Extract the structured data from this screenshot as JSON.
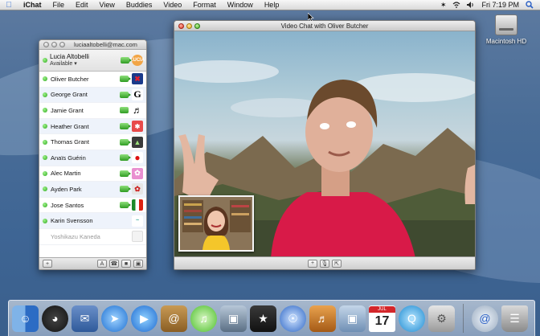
{
  "menubar": {
    "app_name": "iChat",
    "menus": [
      "File",
      "Edit",
      "View",
      "Buddies",
      "Video",
      "Format",
      "Window",
      "Help"
    ],
    "clock": "Fri 7:19 PM"
  },
  "desktop": {
    "hd_label": "Macintosh HD"
  },
  "buddy_list": {
    "account": "luciaaltobelli@mac.com",
    "my_name": "Lucia Altobelli",
    "my_status": "Available ▾",
    "buddies": [
      {
        "name": "Oliver Butcher",
        "online": true,
        "cam": true
      },
      {
        "name": "George Grant",
        "online": true,
        "cam": true
      },
      {
        "name": "Jamie Grant",
        "online": true,
        "phone": true
      },
      {
        "name": "Heather Grant",
        "online": true,
        "cam": true
      },
      {
        "name": "Thomas Grant",
        "online": true,
        "cam": true
      },
      {
        "name": "Anaïs Guérin",
        "online": true,
        "cam": true
      },
      {
        "name": "Alec Martin",
        "online": true,
        "cam": true
      },
      {
        "name": "Ayden Park",
        "online": true,
        "cam": true
      },
      {
        "name": "Jose Santos",
        "online": true,
        "cam": true
      },
      {
        "name": "Karin Svensson",
        "online": true,
        "cam": false
      },
      {
        "name": "Yoshikazu Kaneda",
        "online": false,
        "cam": false
      }
    ],
    "toolbar": {
      "add": "+",
      "text": "A"
    }
  },
  "video_chat": {
    "title": "Video Chat with Oliver Butcher",
    "controls": [
      "+",
      "mute",
      "fullscreen"
    ]
  },
  "dock": {
    "calendar_month": "JUL",
    "calendar_day": "17"
  },
  "colors": {
    "online": "#2ea81f",
    "accent": "#3a73d6",
    "shirt": "#d81a48"
  }
}
